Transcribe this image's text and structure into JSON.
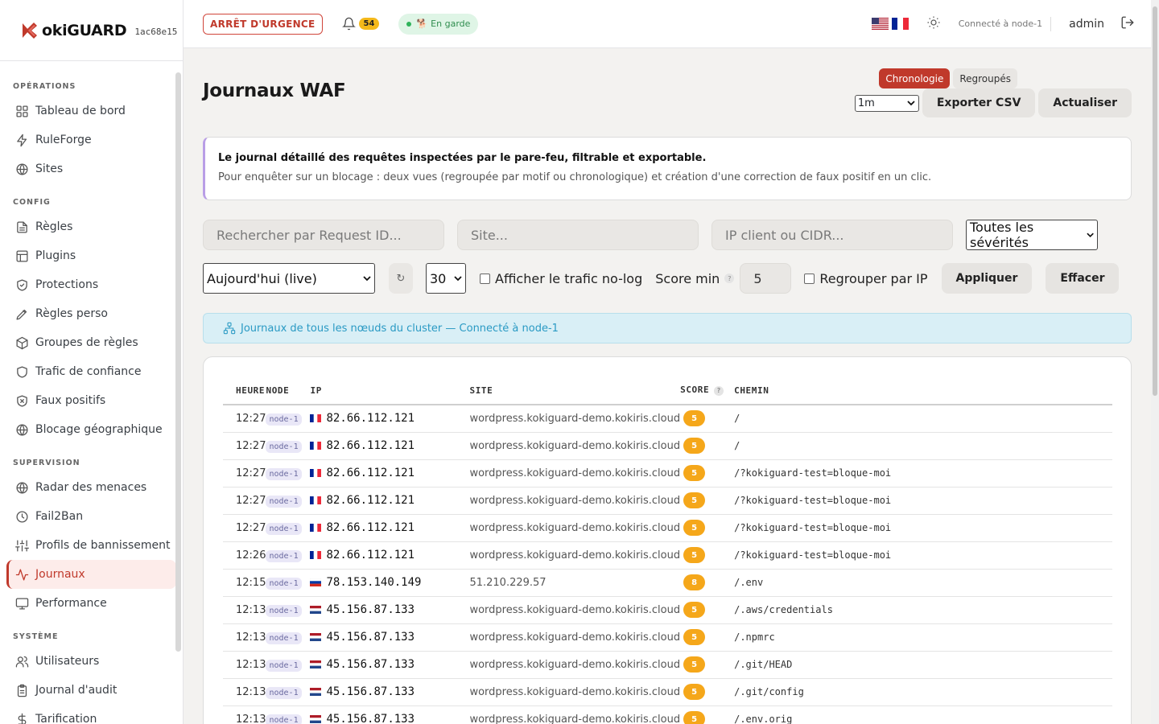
{
  "brand": {
    "name": "okiGUARD",
    "hash": "1ac68e15"
  },
  "sidebar": {
    "sections": [
      {
        "title": "OPÉRATIONS",
        "items": [
          {
            "label": "Tableau de bord",
            "icon": "grid-icon"
          },
          {
            "label": "RuleForge",
            "icon": "bolt-icon"
          },
          {
            "label": "Sites",
            "icon": "globe-icon"
          }
        ]
      },
      {
        "title": "CONFIG",
        "items": [
          {
            "label": "Règles",
            "icon": "file-icon"
          },
          {
            "label": "Plugins",
            "icon": "layout-icon"
          },
          {
            "label": "Protections",
            "icon": "shield-icon"
          },
          {
            "label": "Règles perso",
            "icon": "pen-icon"
          },
          {
            "label": "Groupes de règles",
            "icon": "box-icon"
          },
          {
            "label": "Trafic de confiance",
            "icon": "shield-check-icon"
          },
          {
            "label": "Faux positifs",
            "icon": "shield-x-icon"
          },
          {
            "label": "Blocage géographique",
            "icon": "globe-icon"
          }
        ]
      },
      {
        "title": "SUPERVISION",
        "items": [
          {
            "label": "Radar des menaces",
            "icon": "globe-icon"
          },
          {
            "label": "Fail2Ban",
            "icon": "clock-icon"
          },
          {
            "label": "Profils de bannissement",
            "icon": "sliders-icon"
          },
          {
            "label": "Journaux",
            "icon": "activity-icon",
            "active": true
          },
          {
            "label": "Performance",
            "icon": "monitor-icon"
          }
        ]
      },
      {
        "title": "SYSTÈME",
        "items": [
          {
            "label": "Utilisateurs",
            "icon": "users-icon"
          },
          {
            "label": "Journal d'audit",
            "icon": "clipboard-icon"
          },
          {
            "label": "Tarification",
            "icon": "dollar-icon"
          }
        ]
      }
    ]
  },
  "topbar": {
    "emergency_label": "ARRÊT D'URGENCE",
    "notifications_count": "54",
    "guard_status": "En garde",
    "connected": "Connecté à node-1",
    "user": "admin"
  },
  "page": {
    "title": "Journaux WAF",
    "view_tabs": [
      "Chronologie",
      "Regroupés"
    ],
    "active_view": "Chronologie",
    "refresh_interval": "1m",
    "export_label": "Exporter CSV",
    "refresh_label": "Actualiser",
    "info_title": "Le journal détaillé des requêtes inspectées par le pare-feu, filtrable et exportable.",
    "info_text": "Pour enquêter sur un blocage : deux vues (regroupée par motif ou chronologique) et création d'une correction de faux positif en un clic."
  },
  "filters": {
    "request_id_placeholder": "Rechercher par Request ID...",
    "site_placeholder": "Site...",
    "ip_placeholder": "IP client ou CIDR...",
    "severity": "Toutes les sévérités",
    "period": "Aujourd'hui (live)",
    "refresh_glyph": "↻",
    "limit": "30",
    "nolog_label": "Afficher le trafic no-log",
    "score_min_label": "Score min",
    "score_min_value": "5",
    "group_ip_label": "Regrouper par IP",
    "apply_label": "Appliquer",
    "clear_label": "Effacer"
  },
  "cluster_banner": "Journaux de tous les nœuds du cluster — Connecté à node-1",
  "table": {
    "columns": [
      "HEURE",
      "NODE",
      "IP",
      "SITE",
      "SCORE",
      "CHEMIN"
    ],
    "rows": [
      {
        "time": "12:27",
        "node": "node-1",
        "flag": "fr",
        "ip": "82.66.112.121",
        "site": "wordpress.kokiguard-demo.kokiris.cloud",
        "score": "5",
        "path": "/"
      },
      {
        "time": "12:27",
        "node": "node-1",
        "flag": "fr",
        "ip": "82.66.112.121",
        "site": "wordpress.kokiguard-demo.kokiris.cloud",
        "score": "5",
        "path": "/"
      },
      {
        "time": "12:27",
        "node": "node-1",
        "flag": "fr",
        "ip": "82.66.112.121",
        "site": "wordpress.kokiguard-demo.kokiris.cloud",
        "score": "5",
        "path": "/?kokiguard-test=bloque-moi"
      },
      {
        "time": "12:27",
        "node": "node-1",
        "flag": "fr",
        "ip": "82.66.112.121",
        "site": "wordpress.kokiguard-demo.kokiris.cloud",
        "score": "5",
        "path": "/?kokiguard-test=bloque-moi"
      },
      {
        "time": "12:27",
        "node": "node-1",
        "flag": "fr",
        "ip": "82.66.112.121",
        "site": "wordpress.kokiguard-demo.kokiris.cloud",
        "score": "5",
        "path": "/?kokiguard-test=bloque-moi"
      },
      {
        "time": "12:26",
        "node": "node-1",
        "flag": "fr",
        "ip": "82.66.112.121",
        "site": "wordpress.kokiguard-demo.kokiris.cloud",
        "score": "5",
        "path": "/?kokiguard-test=bloque-moi"
      },
      {
        "time": "12:15",
        "node": "node-1",
        "flag": "ru",
        "ip": "78.153.140.149",
        "site": "51.210.229.57",
        "score": "8",
        "path": "/.env"
      },
      {
        "time": "12:13",
        "node": "node-1",
        "flag": "nl",
        "ip": "45.156.87.133",
        "site": "wordpress.kokiguard-demo.kokiris.cloud",
        "score": "5",
        "path": "/.aws/credentials"
      },
      {
        "time": "12:13",
        "node": "node-1",
        "flag": "nl",
        "ip": "45.156.87.133",
        "site": "wordpress.kokiguard-demo.kokiris.cloud",
        "score": "5",
        "path": "/.npmrc"
      },
      {
        "time": "12:13",
        "node": "node-1",
        "flag": "nl",
        "ip": "45.156.87.133",
        "site": "wordpress.kokiguard-demo.kokiris.cloud",
        "score": "5",
        "path": "/.git/HEAD"
      },
      {
        "time": "12:13",
        "node": "node-1",
        "flag": "nl",
        "ip": "45.156.87.133",
        "site": "wordpress.kokiguard-demo.kokiris.cloud",
        "score": "5",
        "path": "/.git/config"
      },
      {
        "time": "12:13",
        "node": "node-1",
        "flag": "nl",
        "ip": "45.156.87.133",
        "site": "wordpress.kokiguard-demo.kokiris.cloud",
        "score": "5",
        "path": "/.env.orig"
      }
    ]
  },
  "colors": {
    "accent": "#c0392b",
    "score": "#f5a71a",
    "cluster": "#2a9ac4"
  }
}
